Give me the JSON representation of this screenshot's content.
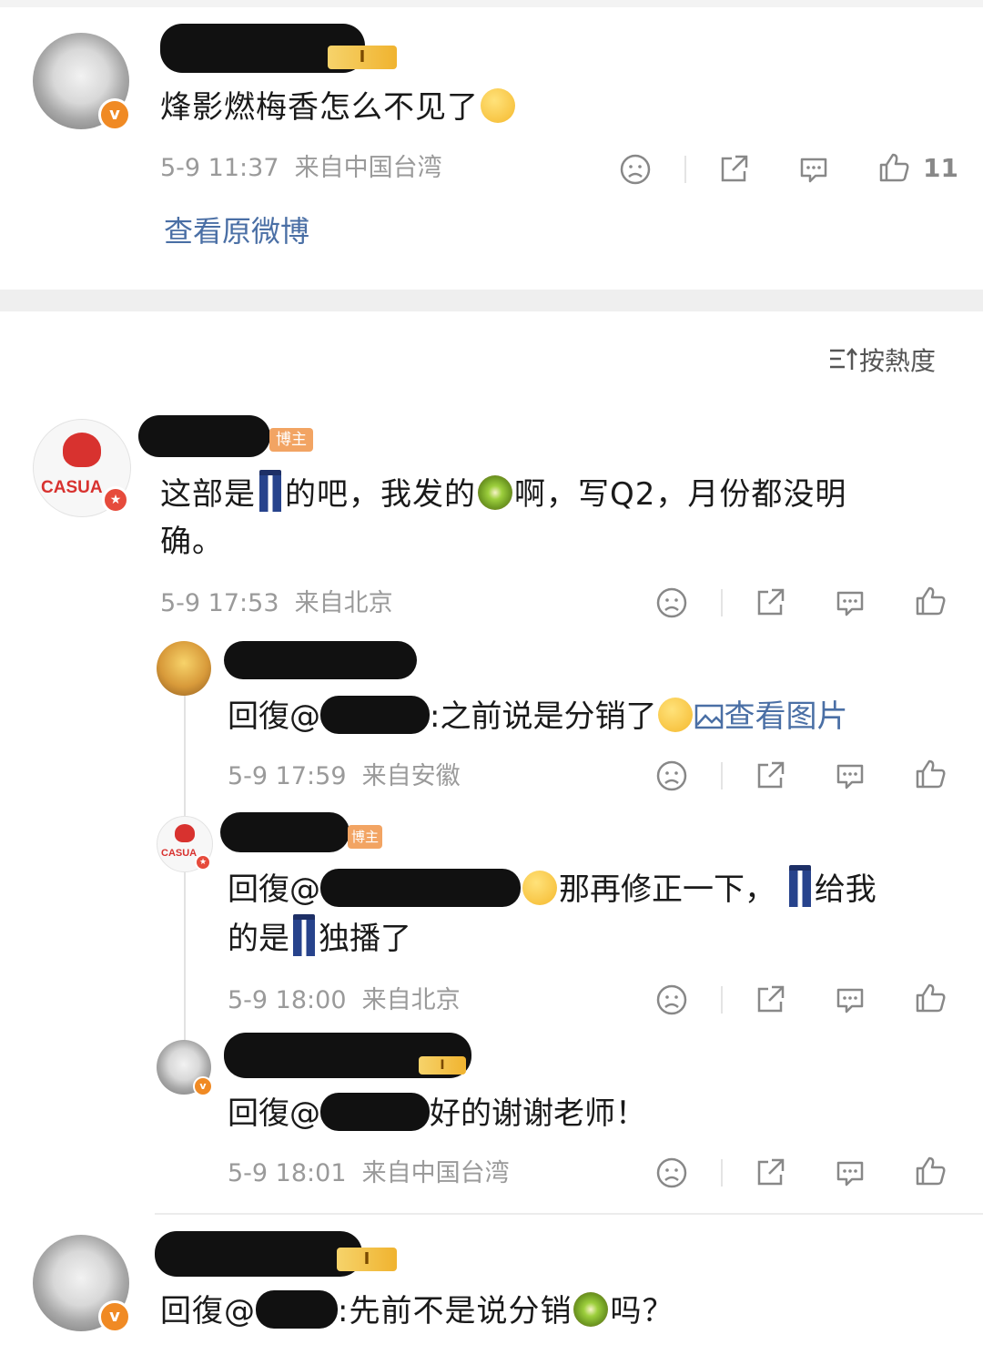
{
  "post": {
    "text": "烽影燃梅香怎么不见了",
    "time": "5-9 11:37",
    "location": "来自中国台湾",
    "like_count": "11",
    "view_original": "查看原微博",
    "level_badge": "I"
  },
  "sort": {
    "label": "按熱度"
  },
  "comment1": {
    "badge": "博主",
    "text_a": "这部是",
    "text_b": "的吧，我发的",
    "text_c": "啊，写Q2，月份都没明",
    "text_d": "确。",
    "time": "5-9 17:53",
    "location": "来自北京",
    "avatar_text": "CASUA"
  },
  "reply1": {
    "prefix": "回復",
    "at": "@",
    "text": ":之前说是分销了",
    "view_image": "查看图片",
    "time": "5-9 17:59",
    "location": "来自安徽"
  },
  "reply2": {
    "badge": "博主",
    "prefix": "回復",
    "at": "@",
    "text_a": "那再修正一下，",
    "text_b": "给我",
    "text_c": "的是",
    "text_d": "独播了",
    "time": "5-9 18:00",
    "location": "来自北京",
    "avatar_text": "CASUA"
  },
  "reply3": {
    "prefix": "回復",
    "at": "@",
    "text": "好的谢谢老师！",
    "time": "5-9 18:01",
    "location": "来自中国台湾",
    "level_badge": "I"
  },
  "comment2": {
    "prefix": "回復",
    "at": "@",
    "text_a": ":先前不是说分销",
    "text_b": "吗？",
    "level_badge": "I"
  },
  "colors": {
    "accent": "#4a6fa5",
    "meta": "#9a9a9a",
    "vip": "#f08a24",
    "bozhu": "#f2a463"
  }
}
